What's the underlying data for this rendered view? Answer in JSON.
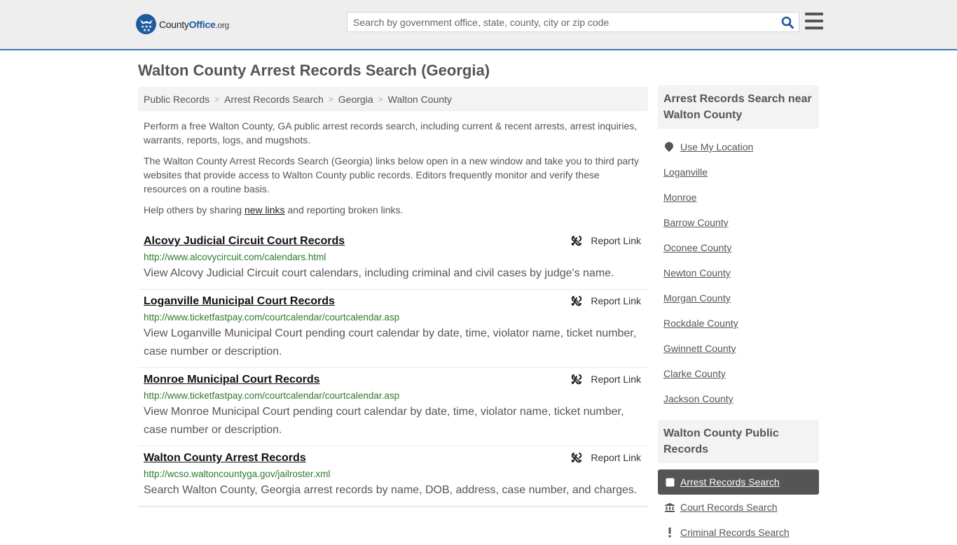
{
  "header": {
    "logo": {
      "brand_part1": "County",
      "brand_part2": "Office",
      "brand_tld": ".org",
      "icon": "eagle-stars-badge-icon"
    },
    "search": {
      "placeholder": "Search by government office, state, county, city or zip code",
      "value": "",
      "icon": "search-icon"
    },
    "menu_icon": "hamburger-menu-icon"
  },
  "page": {
    "title": "Walton County Arrest Records Search (Georgia)"
  },
  "breadcrumb": [
    {
      "label": "Public Records"
    },
    {
      "label": "Arrest Records Search"
    },
    {
      "label": "Georgia"
    },
    {
      "label": "Walton County"
    }
  ],
  "breadcrumb_separator": ">",
  "intro": {
    "p1": "Perform a free Walton County, GA public arrest records search, including current & recent arrests, arrest inquiries, warrants, reports, logs, and mugshots.",
    "p2": "The Walton County Arrest Records Search (Georgia) links below open in a new window and take you to third party websites that provide access to Walton County public records. Editors frequently monitor and verify these resources on a routine basis.",
    "p3_before": "Help others by sharing ",
    "p3_link": "new links",
    "p3_after": " and reporting broken links."
  },
  "report_link_label": "Report Link",
  "records": [
    {
      "title": "Alcovy Judicial Circuit Court Records",
      "url": "http://www.alcovycircuit.com/calendars.html",
      "description": "View Alcovy Judicial Circuit court calendars, including criminal and civil cases by judge's name."
    },
    {
      "title": "Loganville Municipal Court Records",
      "url": "http://www.ticketfastpay.com/courtcalendar/courtcalendar.asp",
      "description": "View Loganville Municipal Court pending court calendar by date, time, violator name, ticket number, case number or description."
    },
    {
      "title": "Monroe Municipal Court Records",
      "url": "http://www.ticketfastpay.com/courtcalendar/courtcalendar.asp",
      "description": "View Monroe Municipal Court pending court calendar by date, time, violator name, ticket number, case number or description."
    },
    {
      "title": "Walton County Arrest Records",
      "url": "http://wcso.waltoncountyga.gov/jailroster.xml",
      "description": "Search Walton County, Georgia arrest records by name, DOB, address, case number, and charges."
    }
  ],
  "sidebar": {
    "nearby_heading": "Arrest Records Search near Walton County",
    "use_location": "Use My Location",
    "nearby": [
      "Loganville",
      "Monroe",
      "Barrow County",
      "Oconee County",
      "Newton County",
      "Morgan County",
      "Rockdale County",
      "Gwinnett County",
      "Clarke County",
      "Jackson County"
    ],
    "public_records_heading": "Walton County Public Records",
    "public_records": [
      {
        "label": "Arrest Records Search",
        "icon": "square-icon",
        "active": true
      },
      {
        "label": "Court Records Search",
        "icon": "courthouse-icon",
        "active": false
      },
      {
        "label": "Criminal Records Search",
        "icon": "exclamation-icon",
        "active": false
      }
    ]
  },
  "colors": {
    "header_bg": "#eeeeee",
    "header_border": "#3a7ab5",
    "brand_blue": "#1d5aa0",
    "url_green": "#2d7a2d",
    "active_bg": "#555555"
  }
}
